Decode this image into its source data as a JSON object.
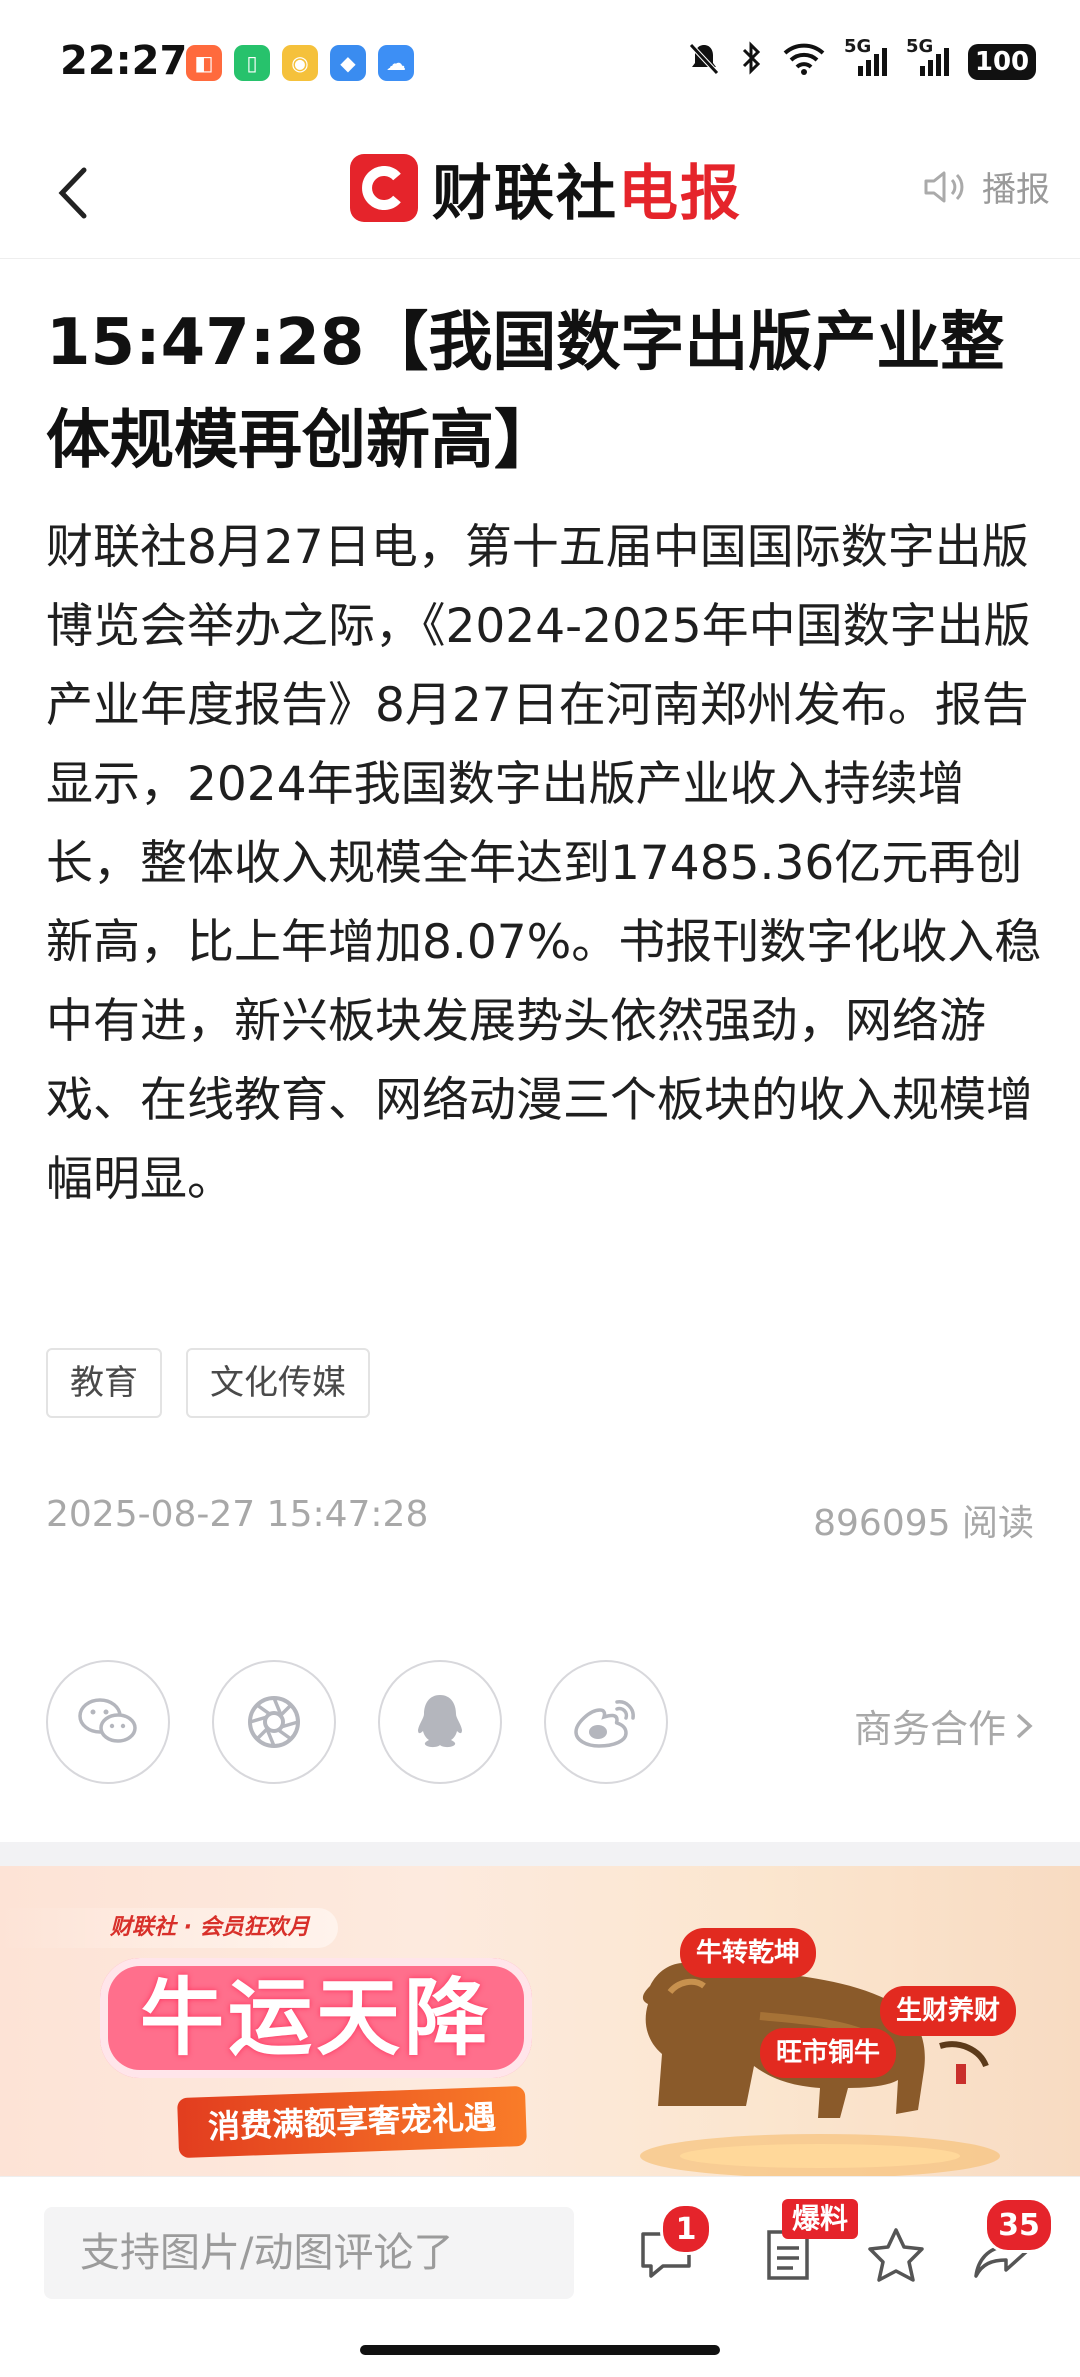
{
  "status_bar": {
    "time": "22:27",
    "network_1": "5G",
    "network_2": "5G",
    "battery": "100"
  },
  "header": {
    "logo_text_a": "财联社",
    "logo_text_b": "电报",
    "broadcast_label": "播报"
  },
  "article": {
    "title": "15:47:28【我国数字出版产业整体规模再创新高】",
    "body": "财联社8月27日电，第十五届中国国际数字出版博览会举办之际，《2024-2025年中国数字出版产业年度报告》8月27日在河南郑州发布。报告显示，2024年我国数字出版产业收入持续增长，整体收入规模全年达到17485.36亿元再创新高，比上年增加8.07%。书报刊数字化收入稳中有进，新兴板块发展势头依然强劲，网络游戏、在线教育、网络动漫三个板块的收入规模增幅明显。",
    "tags": [
      "教育",
      "文化传媒"
    ],
    "date": "2025-08-27 15:47:28",
    "reads": "896095 阅读"
  },
  "share": {
    "icons": [
      "wechat-icon",
      "moments-icon",
      "qq-icon",
      "weibo-icon"
    ],
    "business_label": "商务合作"
  },
  "banner": {
    "brand": "财联社 · 会员狂欢月",
    "headline": "牛运天降",
    "subline": "消费满额享奢宠礼遇",
    "tag_1": "牛转乾坤",
    "tag_2": "旺市铜牛",
    "tag_3": "生财养财"
  },
  "bottom_bar": {
    "comment_placeholder": "支持图片/动图评论了",
    "comment_badge": "1",
    "tip_badge": "爆料",
    "share_badge": "35"
  },
  "colors": {
    "brand_red": "#e5242b",
    "muted_text": "#a8a8a8"
  }
}
